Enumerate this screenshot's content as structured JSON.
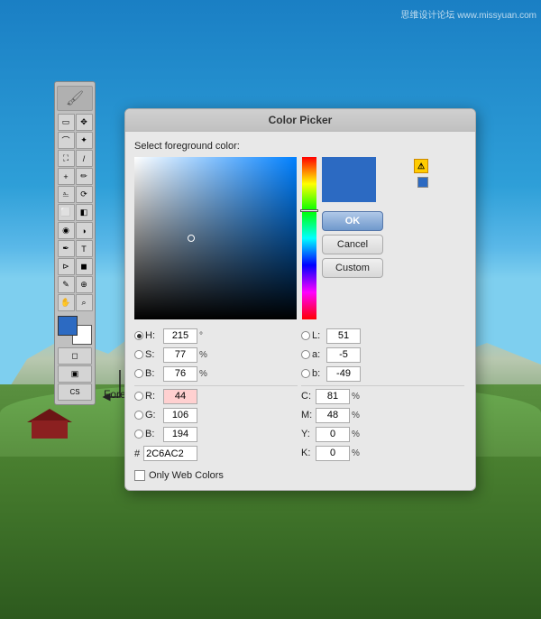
{
  "watermark": "思维设计论坛  www.missyuan.com",
  "dialog": {
    "title": "Color Picker",
    "label": "Select foreground color:",
    "ok_label": "OK",
    "cancel_label": "Cancel",
    "custom_label": "Custom",
    "only_web_colors": "Only Web Colors"
  },
  "color_values": {
    "h_label": "H:",
    "h_value": "215",
    "h_unit": "°",
    "s_label": "S:",
    "s_value": "77",
    "s_unit": "%",
    "b_label": "B:",
    "b_value": "76",
    "b_unit": "%",
    "r_label": "R:",
    "r_value": "44",
    "g_label": "G:",
    "g_value": "106",
    "b2_label": "B:",
    "b2_value": "194",
    "l_label": "L:",
    "l_value": "51",
    "a_label": "a:",
    "a_value": "-5",
    "b3_label": "b:",
    "b3_value": "-49",
    "c_label": "C:",
    "c_value": "81",
    "c_unit": "%",
    "m_label": "M:",
    "m_value": "48",
    "m_unit": "%",
    "y_label": "Y:",
    "y_value": "0",
    "y_unit": "%",
    "k_label": "K:",
    "k_value": "0",
    "k_unit": "%",
    "hex_hash": "#",
    "hex_value": "2C6AC2"
  },
  "toolbar": {
    "foreground_label": "Foreground color"
  },
  "icons": {
    "marquee_rect": "▭",
    "marquee_ellipse": "◯",
    "lasso": "⌒",
    "lasso_poly": "⌒",
    "wand": "✦",
    "crop": "⛶",
    "slice": "/",
    "healing": "+",
    "brush": "✏",
    "stamp": "⎁",
    "history": "⟳",
    "eraser": "⬜",
    "gradient": "◧",
    "blur": "◉",
    "dodge": "◑",
    "pen": "✒",
    "text": "T",
    "shape": "◼",
    "notes": "✎",
    "eyedropper": "⊕",
    "hand": "✋",
    "zoom": "⌕",
    "move": "✥",
    "path": "⊳"
  }
}
